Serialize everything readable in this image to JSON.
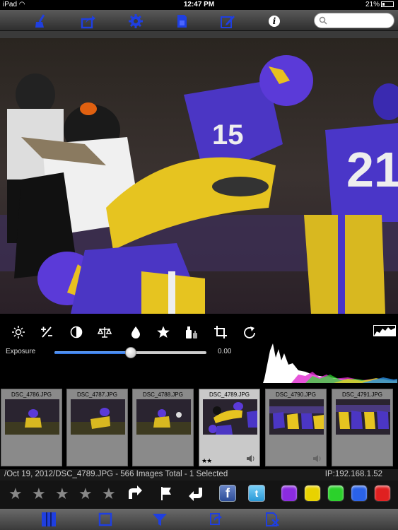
{
  "status": {
    "device": "iPad",
    "time": "12:47 PM",
    "battery": "21%"
  },
  "toolbar": {
    "icons": [
      "broom-icon",
      "share-icon",
      "gear-icon",
      "sd-card-icon",
      "edit-icon",
      "info-icon"
    ],
    "info_glyph": "i",
    "search_placeholder": ""
  },
  "edit_tools": [
    "brightness-icon",
    "plus-minus-icon",
    "contrast-icon",
    "balance-icon",
    "drop-icon",
    "star-icon",
    "bottles-icon",
    "crop-icon",
    "rotate-icon"
  ],
  "exposure": {
    "label": "Exposure",
    "value": "0.00",
    "slider_fraction": 0.5
  },
  "thumbnails": [
    {
      "name": "DSC_4786.JPG",
      "selected": false,
      "stars": ""
    },
    {
      "name": "DSC_4787.JPG",
      "selected": false,
      "stars": ""
    },
    {
      "name": "DSC_4788.JPG",
      "selected": false,
      "stars": ""
    },
    {
      "name": "DSC_4789.JPG",
      "selected": true,
      "stars": "★★"
    },
    {
      "name": "DSC_4790.JPG",
      "selected": false,
      "stars": ""
    },
    {
      "name": "DSC_4791.JPG",
      "selected": false,
      "stars": ""
    }
  ],
  "info": {
    "path": "/Oct 19, 2012/DSC_4789.JPG - 566 Images Total - 1 Selected",
    "ip": "IP:192.168.1.52"
  },
  "actions": {
    "stars": [
      "★",
      "★",
      "★",
      "★",
      "★"
    ],
    "facebook": "f",
    "twitter": "t",
    "colors": [
      "#8b2be0",
      "#e8d200",
      "#2bd12b",
      "#2a62e8",
      "#e02020"
    ]
  },
  "bottom_icons": [
    "grid-view-icon",
    "single-view-icon",
    "filter-icon",
    "sync-icon",
    "delete-icon"
  ],
  "theme": {
    "accent": "#1f3fe0"
  }
}
